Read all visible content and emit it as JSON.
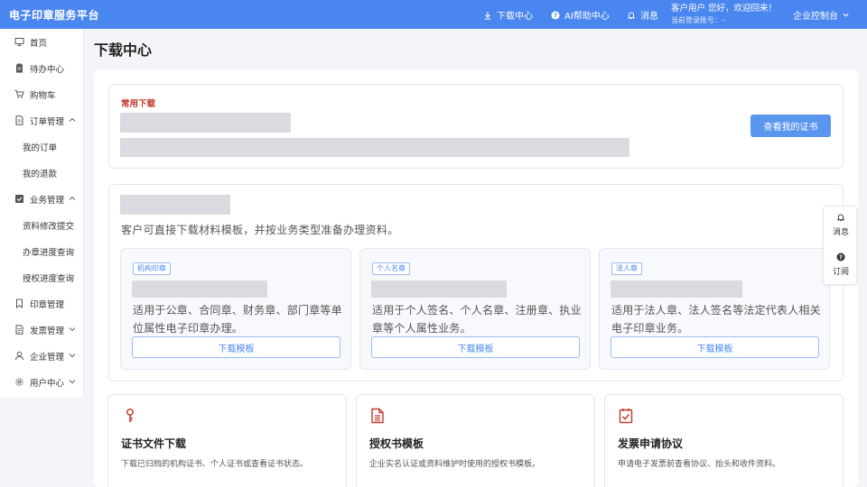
{
  "topbar": {
    "brand": "电子印章服务平台",
    "download_center": "下载中心",
    "ai_help": "AI帮助中心",
    "messages": "消息",
    "user_greeting": "客户用户 您好，欢迎回来！",
    "user_account": "当前登录账号：–",
    "console": "企业控制台"
  },
  "sidebar": {
    "home": "首页",
    "todo": "待办中心",
    "cart": "购物车",
    "orders": "订单管理",
    "my_orders": "我的订单",
    "my_refunds": "我的退款",
    "business": "业务管理",
    "material_change": "资料修改提交",
    "progress_query": "办章进度查询",
    "auth_progress": "授权进度查询",
    "seal_mgmt": "印章管理",
    "invoice_mgmt": "发票管理",
    "enterprise_mgmt": "企业管理",
    "user_center": "用户中心"
  },
  "page": {
    "title": "下载中心"
  },
  "frequent": {
    "label": "常用下载",
    "button": "查看我的证书"
  },
  "templates": {
    "description": "客户可直接下载材料模板，并按业务类型准备办理资料。",
    "cards": [
      {
        "tag": "机构印章",
        "text": "适用于公章、合同章、财务章、部门章等单位属性电子印章办理。",
        "button": "下载模板"
      },
      {
        "tag": "个人名章",
        "text": "适用于个人签名、个人名章、注册章、执业章等个人属性业务。",
        "button": "下载模板"
      },
      {
        "tag": "法人章",
        "text": "适用于法人章、法人签名等法定代表人相关电子印章业务。",
        "button": "下载模板"
      }
    ]
  },
  "bottom_cards": [
    {
      "icon": "key-icon",
      "title": "证书文件下载",
      "desc": "下载已归档的机构证书、个人证书或查看证书状态。"
    },
    {
      "icon": "document-icon",
      "title": "授权书模板",
      "desc": "企业实名认证或资料维护时使用的授权书模板。"
    },
    {
      "icon": "check-doc-icon",
      "title": "发票申请协议",
      "desc": "申请电子发票前查看协议、抬头和收件资料。"
    }
  ],
  "float_widget": {
    "messages": "消息",
    "subscribe": "订阅"
  },
  "colors": {
    "primary": "#4a86f0",
    "button": "#5b96ee",
    "accent_red": "#c0392b"
  }
}
